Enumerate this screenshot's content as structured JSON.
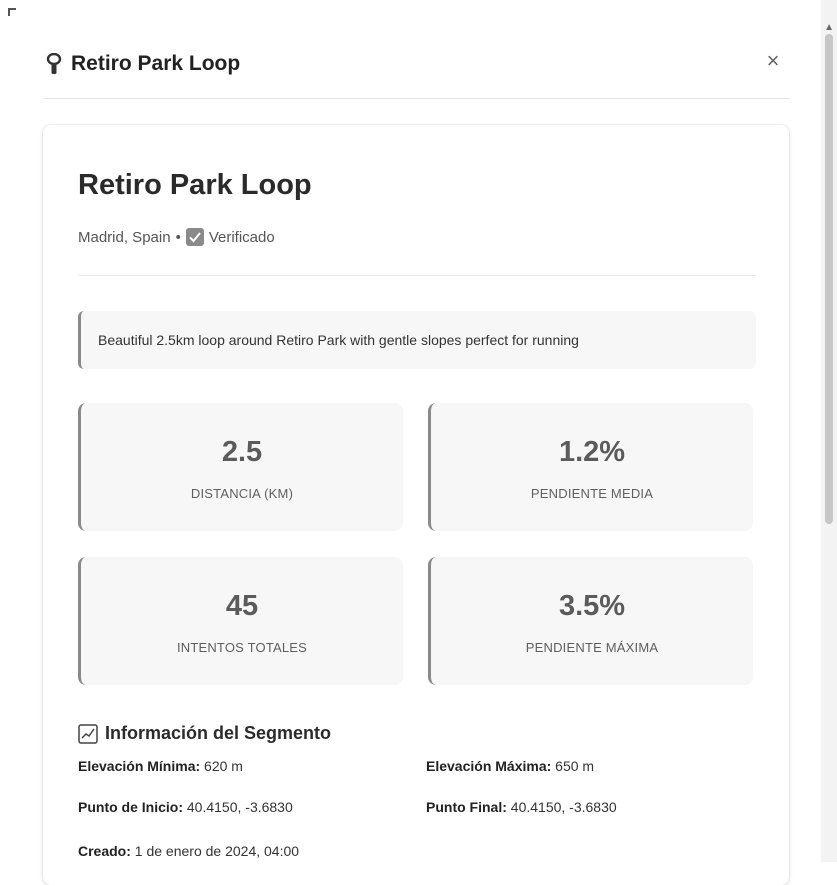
{
  "header": {
    "title": "Retiro Park Loop",
    "close_symbol": "×",
    "pin_icon": "pin-icon"
  },
  "segment": {
    "name": "Retiro Park Loop",
    "location": "Madrid, Spain",
    "separator": "•",
    "verified_label": "Verificado",
    "description": "Beautiful 2.5km loop around Retiro Park with gentle slopes perfect for running"
  },
  "stats": [
    {
      "value": "2.5",
      "label": "DISTANCIA (KM)"
    },
    {
      "value": "1.2%",
      "label": "PENDIENTE MEDIA"
    },
    {
      "value": "45",
      "label": "INTENTOS TOTALES"
    },
    {
      "value": "3.5%",
      "label": "PENDIENTE MÁXIMA"
    }
  ],
  "info": {
    "heading": "Información del Segmento",
    "min_elevation_label": "Elevación Mínima:",
    "min_elevation_value": "620 m",
    "max_elevation_label": "Elevación Máxima:",
    "max_elevation_value": "650 m",
    "start_label": "Punto de Inicio:",
    "start_value": "40.4150, -3.6830",
    "end_label": "Punto Final:",
    "end_value": "40.4150, -3.6830",
    "created_label": "Creado:",
    "created_value": "1 de enero de 2024, 04:00"
  },
  "colors": {
    "accent_gray": "#8a8a8a",
    "card_bg": "#f7f7f7"
  }
}
